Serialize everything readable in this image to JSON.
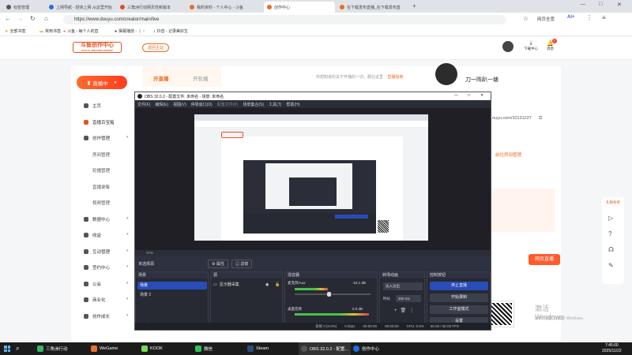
{
  "browser": {
    "tabs": [
      {
        "label": "标签管理",
        "color": "#555"
      },
      {
        "label": "上网导航 - 轻快上网 从这里开始",
        "color": "#2a6de0"
      },
      {
        "label": "三角洲行动网页性新版本",
        "color": "#e24a2d"
      },
      {
        "label": "我的资料 - 个人中心 - 斗鱼",
        "color": "#ef6a1f"
      },
      {
        "label": "创作中心",
        "color": "#ef6a1f"
      },
      {
        "label": "在下载发布直播_在下载发布直",
        "color": "#ef6a1f"
      }
    ],
    "url": "https://www.douyu.com/creator/main/live",
    "bookmarks": [
      "全部书签",
      "常用书签",
      "斗鱼 - 每个人的直",
      "彈幕播放 - 丨・",
      "抖音 - 记录美好生"
    ],
    "ai_label": "AI+",
    "zoom_label": "网页全宽"
  },
  "site": {
    "logo": "斗鱼创作中心",
    "logo_sub": "DOUYU CREATOR CENTER",
    "home_button": "返回主站",
    "download_label": "下载中心",
    "notify_label": "消息",
    "notify_count": "2",
    "live_button": "直播中",
    "tabs": [
      "开直播",
      "开轮播"
    ],
    "notice": "你想知道的关于开播的一切，都在这里",
    "notice_link": "直播指南",
    "username": "刀一阵趴一塘",
    "room_url": "ouyu.com/10131227",
    "side_links": [
      "前往房间管理"
    ],
    "web_live_button": "网页直播",
    "windows_activate": "激活 Windows",
    "windows_activate_sub": "转到“设置”以激活 Windows。"
  },
  "sidebar": [
    {
      "label": "主页",
      "icon": "home-icon",
      "sub": false,
      "chev": false
    },
    {
      "label": "直播百宝箱",
      "icon": "box-icon",
      "sub": false,
      "chev": false
    },
    {
      "label": "创作管理",
      "icon": "create-icon",
      "sub": false,
      "chev": true
    },
    {
      "label": "房间管理",
      "sub": true
    },
    {
      "label": "轮播管理",
      "sub": true
    },
    {
      "label": "直播录像",
      "sub": true
    },
    {
      "label": "视频管理",
      "sub": true
    },
    {
      "label": "数据中心",
      "icon": "data-icon",
      "sub": false,
      "chev": true
    },
    {
      "label": "收益",
      "icon": "income-icon",
      "sub": false,
      "chev": true
    },
    {
      "label": "互动管理",
      "icon": "interact-icon",
      "sub": false,
      "chev": true
    },
    {
      "label": "签约中心",
      "icon": "contract-icon",
      "sub": false,
      "chev": true
    },
    {
      "label": "公会",
      "icon": "guild-icon",
      "sub": false,
      "chev": true
    },
    {
      "label": "商业化",
      "icon": "commerce-icon",
      "sub": false,
      "chev": true
    },
    {
      "label": "创作成长",
      "icon": "growth-icon",
      "sub": false,
      "chev": true
    }
  ],
  "float_bar": [
    "礼物有奖"
  ],
  "obs": {
    "title": "OBS 32.0.2 - 配置文件: 未命名 - 场景: 未命名",
    "menu": [
      "文件(F)",
      "编辑(E)",
      "视图(V)",
      "停靠窗口(D)",
      "配置文件(P)",
      "场景集合(S)",
      "工具(T)",
      "帮助(H)"
    ],
    "no_source": "未选择源",
    "props_button": "属性",
    "filter_button": "滤镜",
    "zoom": "37%",
    "panels": {
      "scenes": {
        "title": "场景",
        "items": [
          "场景",
          "场景 2"
        ]
      },
      "sources": {
        "title": "源",
        "items": [
          "显示器采集"
        ]
      },
      "mixer": {
        "title": "混音器",
        "channels": [
          {
            "name": "麦克风/Aux",
            "db": "-18.1 dB",
            "level": 0.45
          },
          {
            "name": "桌面音频",
            "db": "0.0 dB",
            "level": 0.85
          }
        ]
      },
      "transitions": {
        "title": "转场动画",
        "type": "淡入淡出",
        "duration_label": "时长",
        "duration": "300 ms"
      },
      "controls": {
        "title": "控制按钮",
        "buttons": [
          "停止直播",
          "开始录制",
          "工作室模式",
          "设置"
        ]
      }
    },
    "status": {
      "frames": "丢帧 0 (0.0%)",
      "bitrate": "0 kbps",
      "live_time": "00:00:00",
      "rec_time": "00:00:00",
      "cpu": "CPU: 0.6%",
      "fps": "60.00 / 60.00 FPS"
    }
  },
  "taskbar": {
    "apps": [
      {
        "label": "三角洲行动",
        "color": "#3bb36b"
      },
      {
        "label": "WeGame",
        "color": "#e8702a"
      },
      {
        "label": "KOOK",
        "color": "#7bd85c"
      },
      {
        "label": "微信",
        "color": "#2ec25b"
      },
      {
        "label": "Steam",
        "color": "#2a4d7a"
      },
      {
        "label": "OBS 32.0.2 - 配置...",
        "color": "#333"
      },
      {
        "label": "创作中心",
        "color": "#1e6fe0"
      }
    ],
    "time": "7:45:00",
    "date": "2025/11/22"
  }
}
